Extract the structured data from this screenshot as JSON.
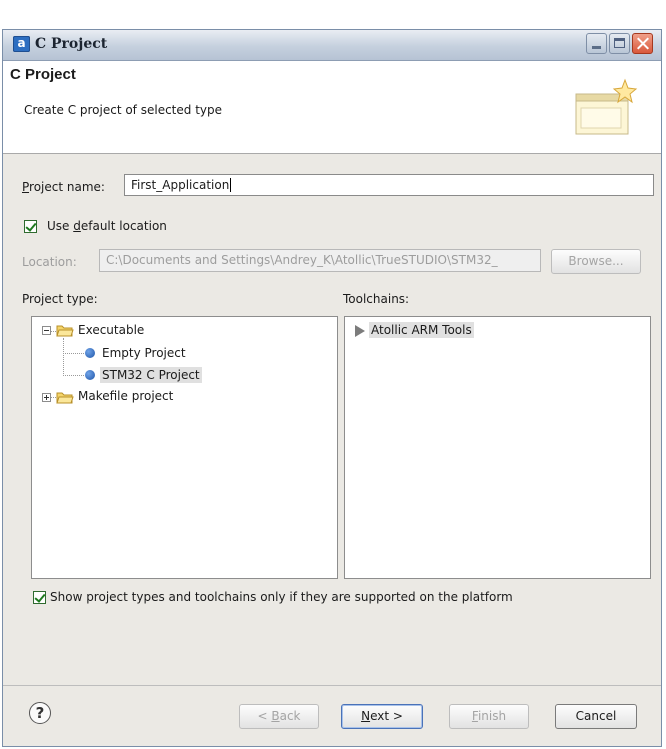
{
  "window": {
    "title": "C Project",
    "app_icon": "a"
  },
  "banner": {
    "title": "C Project",
    "description": "Create C project of selected type",
    "icon": "new-project-wizard-icon"
  },
  "project_name": {
    "label_mnemonic": "P",
    "label_rest": "roject name:",
    "value": "First_Application"
  },
  "use_default_location": {
    "checked": true,
    "label_prefix": "Use ",
    "label_mnemonic": "d",
    "label_rest": "efault location"
  },
  "location": {
    "label": "Location:",
    "value": "C:\\Documents and Settings\\Andrey_K\\Atollic\\TrueSTUDIO\\STM32_",
    "browse_label": "Browse..."
  },
  "project_type": {
    "label": "Project type:",
    "items": [
      {
        "label": "Executable",
        "expanded": true,
        "children": [
          {
            "label": "Empty Project"
          },
          {
            "label": "STM32 C Project",
            "selected": true
          }
        ]
      },
      {
        "label": "Makefile project",
        "expanded": false
      }
    ]
  },
  "toolchains": {
    "label": "Toolchains:",
    "items": [
      {
        "label": "Atollic ARM Tools",
        "selected": true
      }
    ]
  },
  "filter_checkbox": {
    "checked": true,
    "label": "Show project types and toolchains only if they are supported on the platform"
  },
  "buttons": {
    "help": "?",
    "back": {
      "prefix": "< ",
      "mnemonic": "B",
      "rest": "ack",
      "enabled": false
    },
    "next": {
      "mnemonic": "N",
      "rest": "ext >",
      "enabled": true
    },
    "finish": {
      "mnemonic": "F",
      "rest": "inish",
      "enabled": false
    },
    "cancel": {
      "label": "Cancel",
      "enabled": true
    }
  }
}
